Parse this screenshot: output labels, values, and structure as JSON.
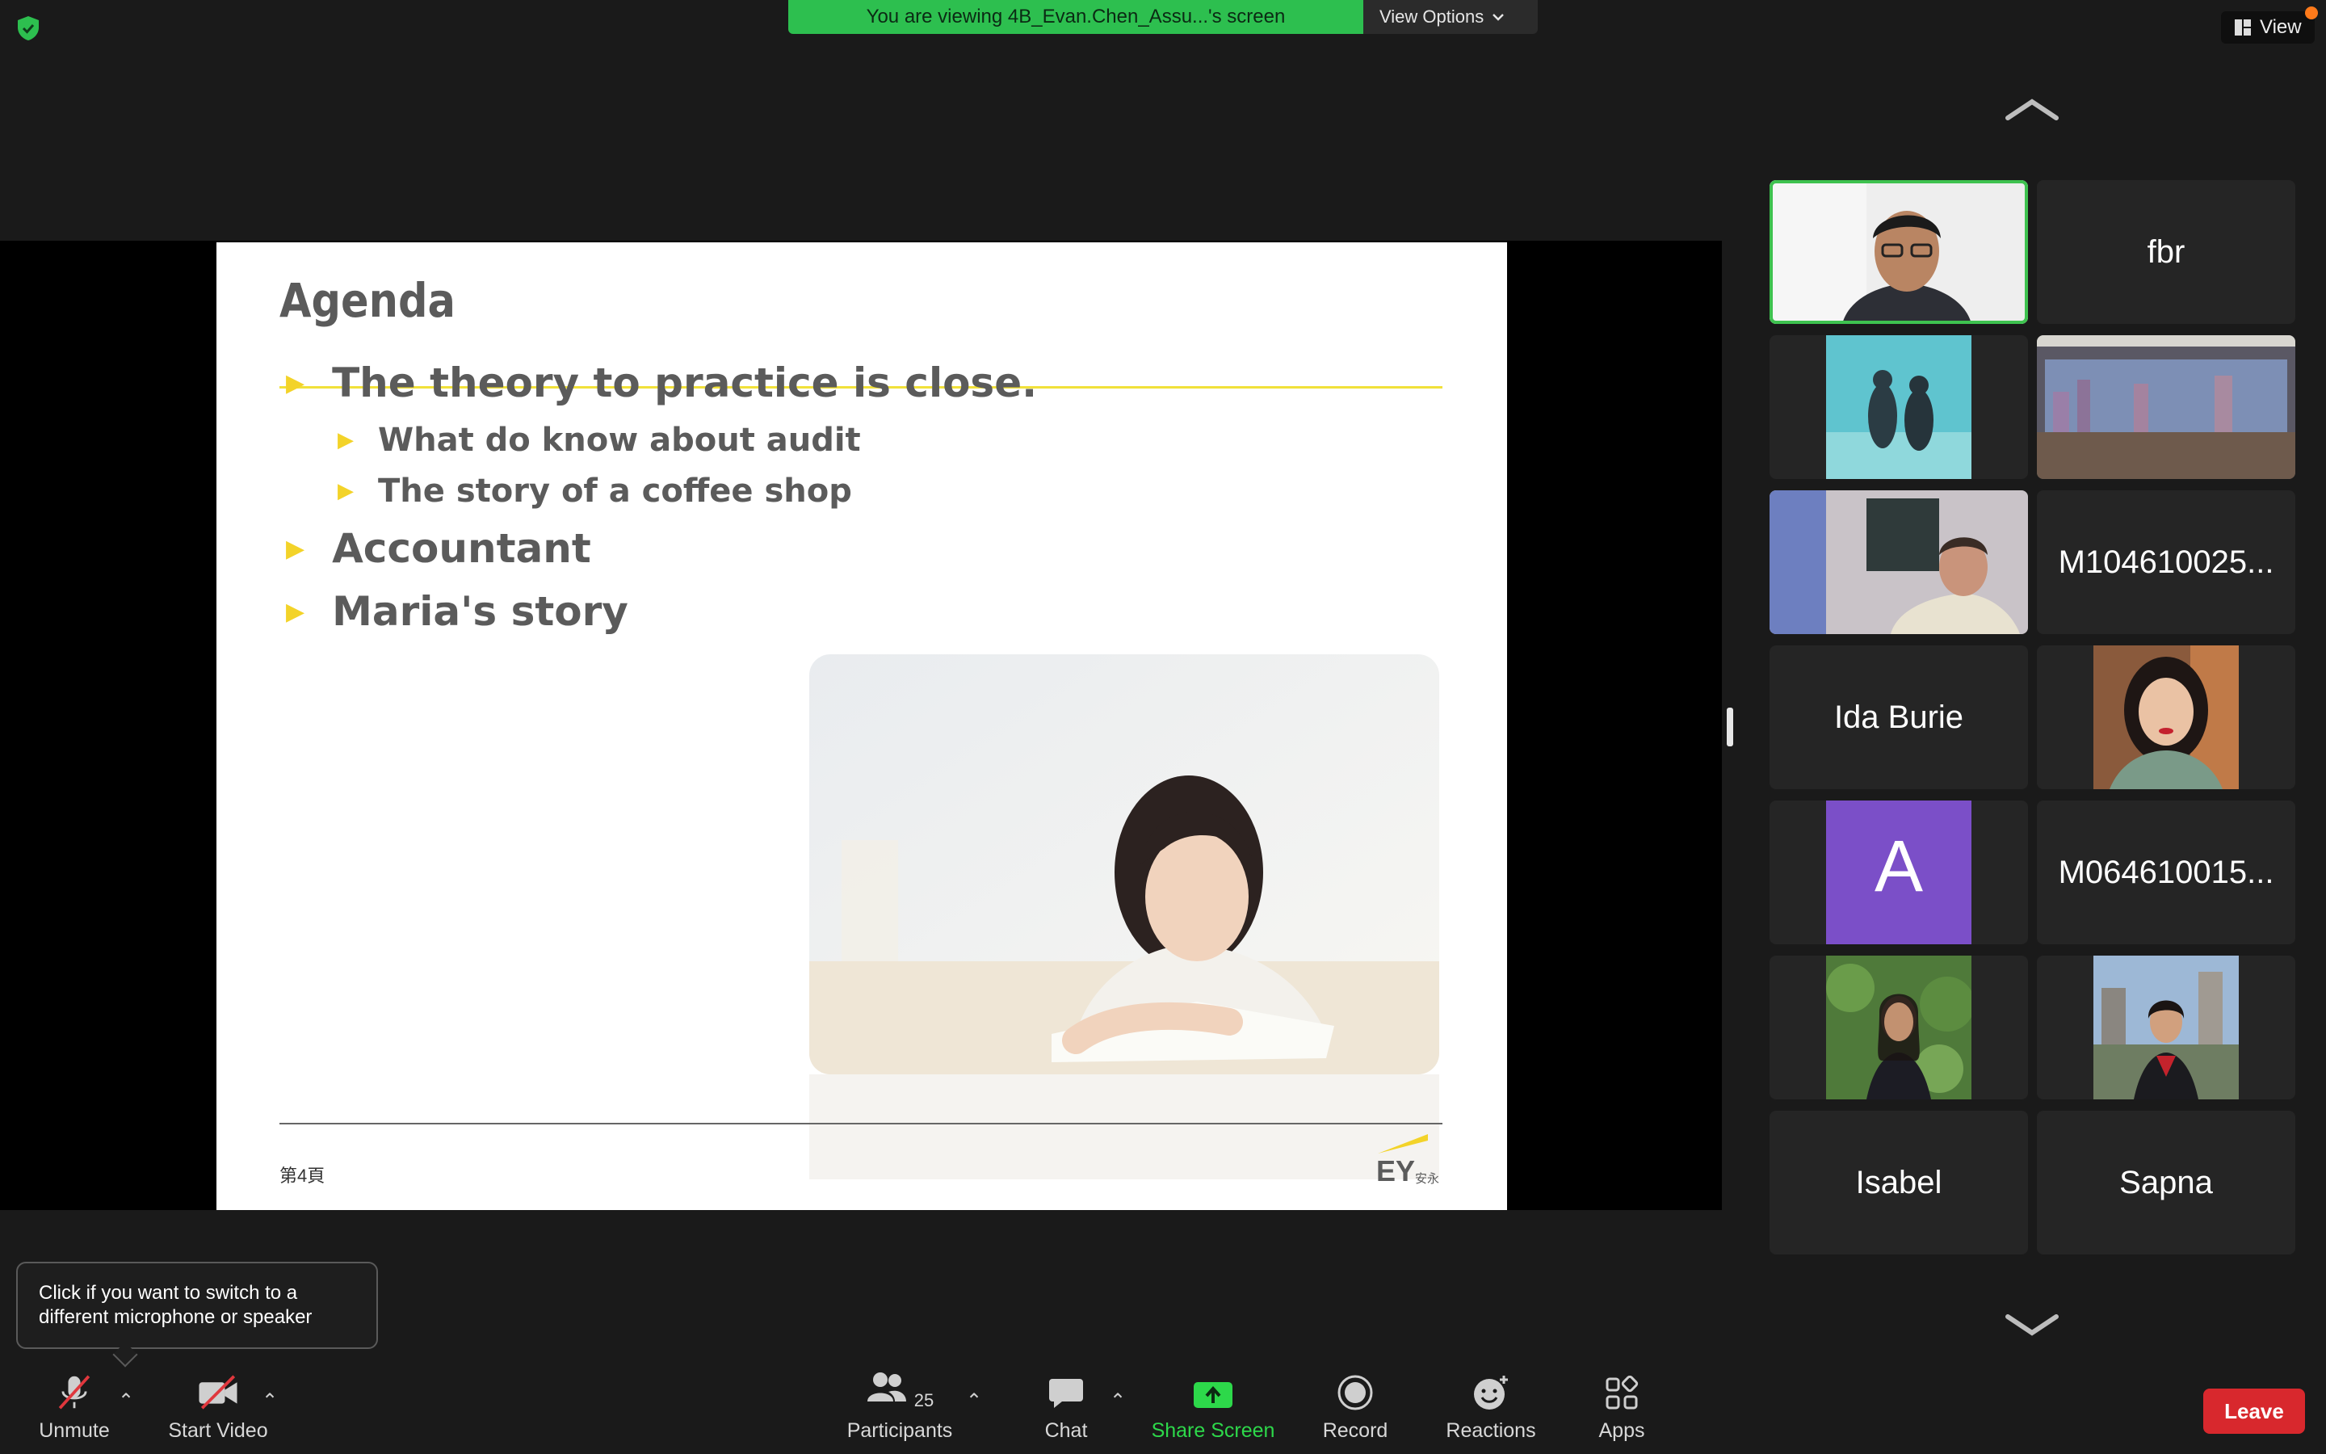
{
  "banner": {
    "viewing_text": "You are viewing 4B_Evan.Chen_Assu...'s screen",
    "view_options_label": "View Options",
    "view_label": "View"
  },
  "slide": {
    "title": "Agenda",
    "bullets": [
      "The theory to practice is close.",
      "What do know about audit",
      "The story of a coffee shop",
      "Accountant",
      "Maria's story"
    ],
    "page_number": "第4頁",
    "logo_text": "EY",
    "logo_subtext": "安永"
  },
  "gallery": {
    "tiles": [
      {
        "type": "video",
        "icon": "participant-video-man-glasses",
        "active": true
      },
      {
        "type": "name",
        "name": "fbr"
      },
      {
        "type": "video",
        "icon": "participant-video-underwater"
      },
      {
        "type": "video",
        "icon": "participant-video-city-room"
      },
      {
        "type": "video",
        "icon": "participant-video-man-reading"
      },
      {
        "type": "name",
        "name": "M104610025..."
      },
      {
        "type": "name",
        "name": "Ida Burie"
      },
      {
        "type": "video",
        "icon": "participant-photo-woman-red-lips"
      },
      {
        "type": "avatar",
        "letter": "A",
        "color": "#7b4fc8"
      },
      {
        "type": "name",
        "name": "M064610015..."
      },
      {
        "type": "video",
        "icon": "participant-photo-woman-plants"
      },
      {
        "type": "video",
        "icon": "participant-photo-woman-city"
      },
      {
        "type": "name",
        "name": "Isabel"
      },
      {
        "type": "name",
        "name": "Sapna"
      }
    ]
  },
  "tooltip": {
    "text_line1": "Click if you want to switch to a",
    "text_line2": "different microphone or speaker"
  },
  "toolbar": {
    "unmute_label": "Unmute",
    "start_video_label": "Start Video",
    "participants_label": "Participants",
    "participants_count": "25",
    "chat_label": "Chat",
    "share_screen_label": "Share Screen",
    "record_label": "Record",
    "reactions_label": "Reactions",
    "apps_label": "Apps",
    "leave_label": "Leave"
  },
  "colors": {
    "banner_green": "#2dbf4f",
    "active_speaker": "#3ec24f",
    "leave_red": "#d8282d",
    "slide_accent": "#f1e13a"
  }
}
